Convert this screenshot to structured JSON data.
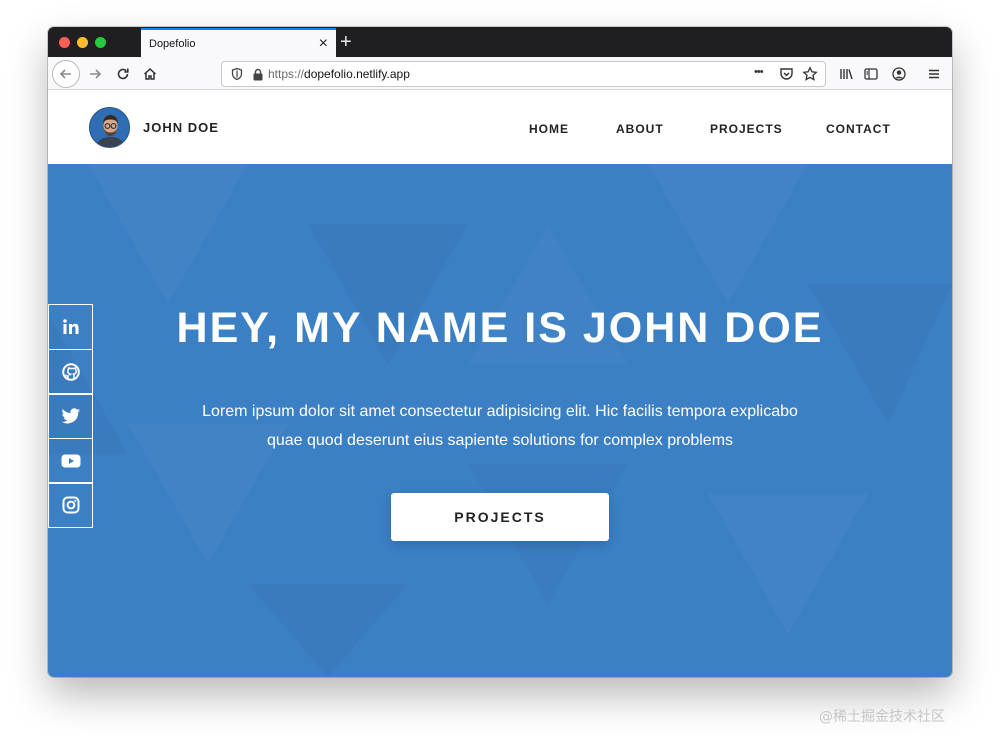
{
  "browser": {
    "tab_title": "Dopefolio",
    "tab_close": "×",
    "new_tab": "+",
    "url_protocol": "https://",
    "url_host": "dopefolio.netlify.app",
    "page_actions": "•••"
  },
  "site": {
    "brand": "JOHN DOE",
    "nav": [
      "HOME",
      "ABOUT",
      "PROJECTS",
      "CONTACT"
    ]
  },
  "hero": {
    "title": "HEY, MY NAME IS JOHN DOE",
    "subtitle_line1": "Lorem ipsum dolor sit amet consectetur adipisicing elit. Hic facilis tempora explicabo",
    "subtitle_line2": "quae quod deserunt eius sapiente solutions for complex problems",
    "cta_label": "PROJECTS",
    "background_color": "#3b7fc4"
  },
  "social": [
    "linkedin-icon",
    "github-icon",
    "twitter-icon",
    "youtube-icon",
    "instagram-icon"
  ],
  "watermark": "@稀土掘金技术社区"
}
